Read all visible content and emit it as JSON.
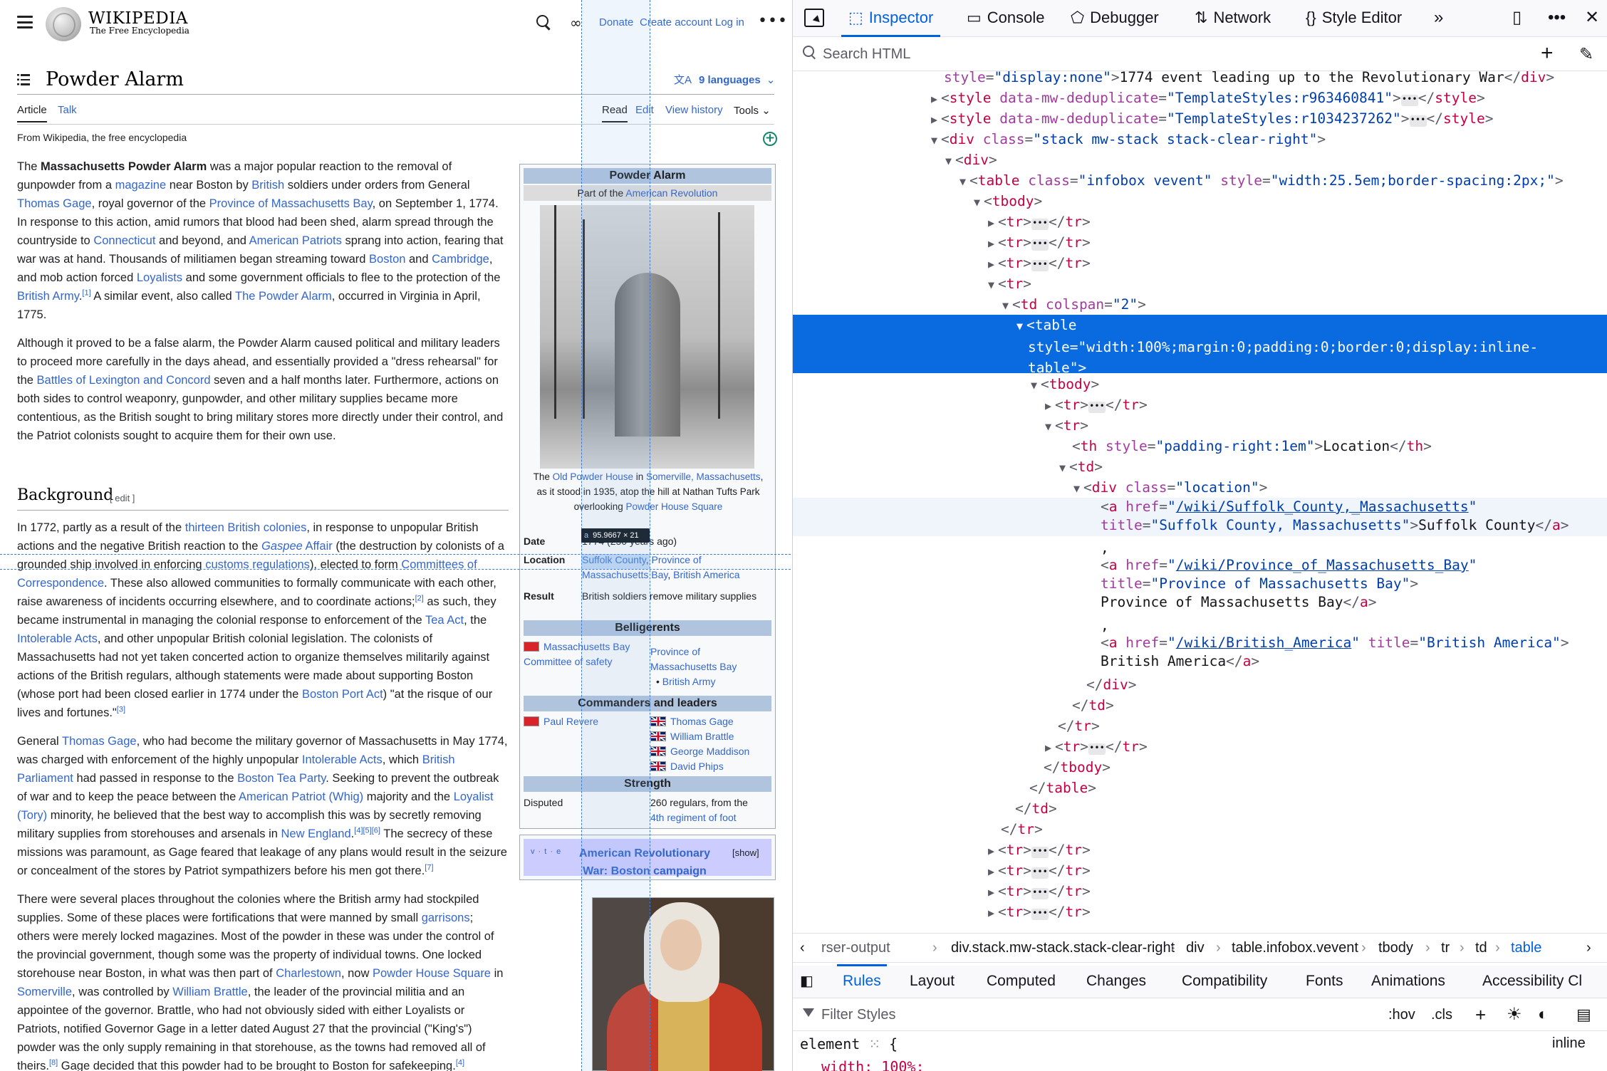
{
  "wiki": {
    "wordmark": "Wikipedia",
    "tagline": "The Free Encyclopedia",
    "header_links": {
      "donate": "Donate",
      "create_account": "Create account",
      "log_in": "Log in"
    },
    "title": "Powder Alarm",
    "languages": "9 languages",
    "tabs": {
      "article": "Article",
      "talk": "Talk",
      "read": "Read",
      "edit": "Edit",
      "history": "View history",
      "tools": "Tools"
    },
    "from": "From Wikipedia, the free encyclopedia",
    "section_background": "Background",
    "section_edit": "[ edit ]",
    "infobox": {
      "title": "Powder Alarm",
      "part_of_prefix": "Part of the ",
      "part_of_link": "American Revolution",
      "caption": {
        "t1": "The ",
        "l1": "Old Powder House",
        "t2": " in ",
        "l2": "Somerville, Massachusetts",
        "t3": ", as it stood in 1935, atop the hill at Nathan Tufts Park overlooking ",
        "l3": "Powder House Square"
      },
      "date_label": "Date",
      "date_value": "1774 (250 years ago)",
      "location_label": "Location",
      "loc_1": "Suffolk County",
      "loc_2": "Province of Massachusetts Bay",
      "loc_3": "British America",
      "result_label": "Result",
      "result_value": "British soldiers remove military supplies",
      "belligerents": "Belligerents",
      "bel_left": "Massachusetts Bay Committee of safety",
      "bel_right": "Province of Massachusetts Bay",
      "bel_right_2": "British Army",
      "commanders": "Commanders and leaders",
      "cmd_left": "Paul Revere",
      "cmd_right": [
        "Thomas Gage",
        "William Brattle",
        "George Maddison",
        "David Phips"
      ],
      "strength": "Strength",
      "str_left": "Disputed",
      "str_right_1": "260 regulars, from the",
      "str_right_2": "4th regiment of foot"
    },
    "navbox": {
      "vte": "v · t · e",
      "title": "American Revolutionary War: Boston campaign",
      "show": "[show]"
    },
    "dim_tip": {
      "tag": "a",
      "size": "95.9667 × 21"
    }
  },
  "devtools": {
    "tabs": {
      "inspector": "Inspector",
      "console": "Console",
      "debugger": "Debugger",
      "network": "Network",
      "style_editor": "Style Editor"
    },
    "search_placeholder": "Search HTML",
    "lines": [
      {
        "text": "style=\"display:none\">1774 event leading up to the Revolutionary War</div>"
      },
      {
        "text": "<style data-mw-deduplicate=\"TemplateStyles:r963460841\">…</style>"
      },
      {
        "text": "<style data-mw-deduplicate=\"TemplateStyles:r1034237262\">…</style>"
      },
      {
        "text": "<div class=\"stack mw-stack stack-clear-right\">"
      },
      {
        "text": "<div>"
      },
      {
        "text": "<table class=\"infobox vevent\" style=\"width:25.5em;border-spacing:2px;\">"
      },
      {
        "text": "<tbody>"
      },
      {
        "text": "<tr>…</tr>"
      },
      {
        "text": "<tr>…</tr>"
      },
      {
        "text": "<tr>…</tr>"
      },
      {
        "text": "<tr>"
      },
      {
        "text": "<td colspan=\"2\">"
      },
      {
        "text": "<table style=\"width:100%;margin:0;padding:0;border:0;display:inline-table\">"
      },
      {
        "text": "<tbody>"
      },
      {
        "text": "<tr>…</tr>"
      },
      {
        "text": "<tr>"
      },
      {
        "text": "<th style=\"padding-right:1em\">Location</th>"
      },
      {
        "text": "<td>"
      },
      {
        "text": "<div class=\"location\">"
      },
      {
        "text": "<a href=\"/wiki/Suffolk_County,_Massachusetts\" title=\"Suffolk County, Massachusetts\">Suffolk County</a>"
      },
      {
        "text": ","
      },
      {
        "text": "<a href=\"/wiki/Province_of_Massachusetts_Bay\" title=\"Province of Massachusetts Bay\"> Province of Massachusetts Bay</a>"
      },
      {
        "text": ","
      },
      {
        "text": "<a href=\"/wiki/British_America\" title=\"British America\"> British America</a>"
      },
      {
        "text": "</div>"
      },
      {
        "text": "</td>"
      },
      {
        "text": "</tr>"
      },
      {
        "text": "<tr>…</tr>"
      },
      {
        "text": "</tbody>"
      },
      {
        "text": "</table>"
      },
      {
        "text": "</td>"
      },
      {
        "text": "</tr>"
      },
      {
        "text": "<tr>…</tr>"
      }
    ],
    "breadcrumbs": [
      "rser-output",
      "div.stack.mw-stack.stack-clear-right",
      "div",
      "table.infobox.vevent",
      "tbody",
      "tr",
      "td",
      "table"
    ],
    "sidebar_tabs": [
      "Rules",
      "Layout",
      "Computed",
      "Changes",
      "Compatibility",
      "Fonts",
      "Animations",
      "Accessibility Cl"
    ],
    "filter_placeholder": "Filter Styles",
    "hov": ":hov",
    "cls": ".cls",
    "rule_selector": "element",
    "rule_open": "{",
    "rule_prop": "width: 100%;",
    "inline_label": "inline"
  }
}
